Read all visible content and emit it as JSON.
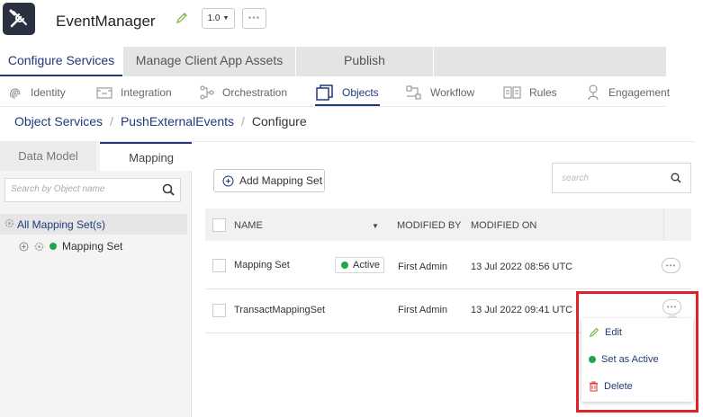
{
  "header": {
    "app_name": "EventManager",
    "version": "1.0",
    "more": "•••"
  },
  "top_tabs": [
    {
      "label": "Configure Services",
      "active": true
    },
    {
      "label": "Manage Client App Assets",
      "active": false
    },
    {
      "label": "Publish",
      "active": false
    }
  ],
  "services": [
    {
      "label": "Identity",
      "icon": "fingerprint-icon"
    },
    {
      "label": "Integration",
      "icon": "integration-icon"
    },
    {
      "label": "Orchestration",
      "icon": "orchestration-icon"
    },
    {
      "label": "Objects",
      "icon": "objects-icon",
      "active": true
    },
    {
      "label": "Workflow",
      "icon": "workflow-icon"
    },
    {
      "label": "Rules",
      "icon": "rules-icon"
    },
    {
      "label": "Engagement",
      "icon": "engagement-icon"
    }
  ],
  "breadcrumb": {
    "items": [
      "Object Services",
      "PushExternalEvents"
    ],
    "current": "Configure",
    "separator": "/"
  },
  "left_panel": {
    "tabs": [
      "Data Model",
      "Mapping"
    ],
    "search_placeholder": "Search by Object name",
    "tree_root": "All Mapping Set(s)",
    "tree_child": "Mapping Set"
  },
  "main": {
    "add_button": "Add Mapping Set",
    "search_placeholder": "search",
    "columns": [
      "NAME",
      "MODIFIED BY",
      "MODIFIED ON"
    ],
    "rows": [
      {
        "name": "Mapping Set",
        "badge": "Active",
        "modified_by": "First Admin",
        "modified_on": "13 Jul 2022 08:56 UTC"
      },
      {
        "name": "TransactMappingSet",
        "badge": "",
        "modified_by": "First Admin",
        "modified_on": "13 Jul 2022 09:41 UTC"
      }
    ],
    "more": "•••"
  },
  "context_menu": {
    "edit": "Edit",
    "set_active": "Set as Active",
    "delete": "Delete"
  },
  "colors": {
    "accent": "#1f3a7a",
    "active_green": "#1fa64a",
    "delete_red": "#d9342b",
    "highlight": "#e0202a"
  }
}
